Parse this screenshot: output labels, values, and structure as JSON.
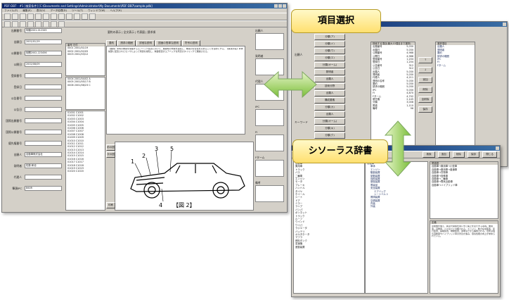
{
  "main_window": {
    "title": "PDF-DB7 - #1 [検索条件] [C:\\Documents and Settings\\Administrator\\My Documents\\PDF-DB7\\sample.pdb]",
    "menu": [
      "ファイル(F)",
      "編集(E)",
      "表示(V)",
      "データ処理(D)",
      "ツール(T)",
      "ウィンドウ(W)",
      "ヘルプ(H)"
    ],
    "form_labels": [
      "出願番号",
      "出願日",
      "公開番号",
      "公開日",
      "登録番号",
      "登録日",
      "公告番号",
      "公告日",
      "国際出願番号",
      "国際公開番号",
      "優先権番号",
      "出願人",
      "発明者",
      "代理人",
      "筆頭IPC"
    ],
    "form_values": [
      "特願2001-012345",
      "2001/01/19",
      "特開2002-223456",
      "2002/08/09",
      "",
      "",
      "",
      "",
      "",
      "",
      "",
      "自動車株式会社",
      "佐藤 和也",
      "",
      "B60R"
    ],
    "center_header": "要約の表示 | 全文表示 | 代表図 | 請求項",
    "tabs": [
      "要約",
      "請求の範囲",
      "詳細な説明",
      "図面の簡単な説明",
      "符号の説明"
    ],
    "abstract_text": "【課題】車両の乗員を保護するエアバッグ装置において、展開時の衝撃を緩和し、乗員の安全性を高めることを目的とする。【解決手段】車体前部に配置されたセンサによって衝突を検知し、制御装置がエアバッグを所定のタイミングで展開させる。",
    "list_header_a": [
      "番号",
      "日付"
    ],
    "list_rows_a": [
      "0001 2001/01/19",
      "0002 2001/02/05",
      "0003 2001/03/12"
    ],
    "list_rows_b": [
      "0004 2001/04/02  A",
      "0005 2001/05/17  B",
      "0006 2001/06/23  C"
    ],
    "list_rows_c": [
      "01001 C1001",
      "01002 C1002",
      "01003 C1003",
      "01004 C1004",
      "01005 C1005",
      "01006 C1006",
      "01007 C1007",
      "01008 C1008",
      "01009 C1009",
      "01010 C1010",
      "01011 C1011",
      "01012 C1012",
      "01013 C1013",
      "01014 C1014",
      "01015 C1015",
      "01016 C1016",
      "01017 C1017",
      "01018 C1018",
      "01019 C1019",
      "01020 C1020"
    ],
    "figure_numbers": [
      "1",
      "2",
      "3",
      "4",
      "5"
    ],
    "figure_caption": "【図 2】",
    "side_buttons": [
      "前の図",
      "次の図",
      "印刷"
    ],
    "right_labels": [
      "出願人",
      "発明者",
      "代理人",
      "IPC",
      "FI",
      "Fターム",
      "備考"
    ]
  },
  "item_window": {
    "search_label": "検索",
    "fields_header": "検索する項目(最大10項目まで選択)",
    "list_items": [
      "出願番号",
      "出願日",
      "公開番号",
      "公開日",
      "登録番号",
      "登録日",
      "公告番号",
      "公告日",
      "出願人",
      "発明者",
      "代理人",
      "発明の名称",
      "要約",
      "請求の範囲",
      "IPC",
      "FI",
      "Fターム",
      "優先権",
      "分類",
      "関連",
      "備考"
    ],
    "list_values": [
      "5,030",
      "5,030",
      "4,988",
      "4,988",
      "1,204",
      "1,204",
      "312",
      "312",
      "5,030",
      "5,030",
      "4,211",
      "5,030",
      "5,030",
      "5,030",
      "5,030",
      "4,870",
      "4,702",
      "2,145",
      "3,008",
      "1,110",
      "96"
    ],
    "group_labels": [
      "出願人",
      "キーワード"
    ],
    "group_buttons": [
      "分類(ア)",
      "分類(イ)",
      "分類(ウ)",
      "分類(エ)",
      "分類(オーム)",
      "発明者",
      "出願人",
      "技術分野",
      "出願人",
      "構成要素",
      "分類(カ)",
      "出願人",
      "分類(オーム)",
      "分類(キ)",
      "分類(ク)",
      "分類(ケ)",
      "出願人",
      "構成要素"
    ],
    "action_buttons": [
      "↑",
      "↓",
      "追加",
      "削除",
      "全削除",
      "保存"
    ],
    "right_header": "選択項目",
    "right_list": [
      "出願人",
      "発明者",
      "要約",
      "請求の範囲",
      "IPC",
      "FI",
      "Fターム"
    ]
  },
  "thesaurus_window": {
    "toolbar": [
      "検索",
      "追加",
      "削除",
      "保存",
      "閉じる"
    ],
    "tree_items": [
      "自動車",
      "車体",
      "エンジン",
      "駆動装置",
      "制動装置",
      "操舵装置",
      "懸架装置",
      "電装品",
      "安全装置",
      "エアバッグ",
      "シートベルト",
      "照明装置",
      "空調装置",
      "内装",
      "外装"
    ],
    "list_col": [
      "自動車",
      "乗用車",
      "トラック",
      "バス",
      "二輪車",
      "エンジン",
      "モータ",
      "ブレーキ",
      "ハンドル",
      "タイヤ",
      "ホイール",
      "シート",
      "ドア",
      "ミラー",
      "ランプ",
      "バンパ",
      "ボンネット",
      "トランク",
      "ルーフ",
      "ウインド",
      "ワイパ",
      "ラジエータ",
      "バッテリ",
      "オルタネータ",
      "マフラ",
      "燃料タンク",
      "変速機",
      "差動装置"
    ],
    "right_header": "関連語",
    "right_items": [
      "自動車→乗用車→小型車",
      "自動車→乗用車→普通車",
      "自動車→貨物車",
      "自動車→特殊車",
      "自動車→二輪車",
      "自動車→電気自動車",
      "自動車→ハイブリッド車"
    ],
    "definition_header": "定義",
    "definition_text": "原動機を備え、軌道や架線を用いずに路上を走行する車両。乗用車、貨物車、バスなどに分類される。エンジン、動力伝達装置、走行装置、操縦装置、制動装置、車体などから構成される。近年は電気自動車やハイブリッド車の普及が進み、環境性能の向上が求められている。"
  },
  "callouts": {
    "item_select": "項目選択",
    "thesaurus": "シソーラス辞書"
  }
}
